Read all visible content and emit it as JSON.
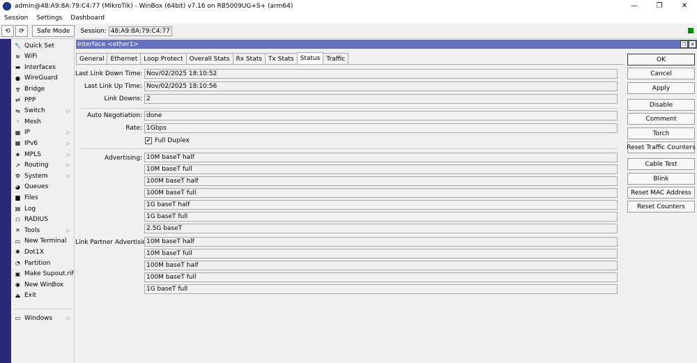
{
  "window": {
    "title": "admin@48:A9:8A:79:C4:77 (MikroTik) - WinBox (64bit) v7.16 on RB5009UG+S+ (arm64)",
    "minimize": "—",
    "maximize": "❐",
    "close": "✕"
  },
  "menu": [
    "Session",
    "Settings",
    "Dashboard"
  ],
  "toolbar": {
    "undo": "⟲",
    "redo": "⟳",
    "safe_mode": "Safe Mode",
    "session_label": "Session:",
    "session_value": "48:A9:8A:79:C4:77"
  },
  "sidebar": [
    {
      "label": "Quick Set",
      "icon": "quick-set-icon",
      "glyph": "🔧",
      "arrow": false
    },
    {
      "label": "WiFi",
      "icon": "wifi-icon",
      "glyph": "≋",
      "arrow": false
    },
    {
      "label": "Interfaces",
      "icon": "interfaces-icon",
      "glyph": "▬",
      "arrow": false
    },
    {
      "label": "WireGuard",
      "icon": "wireguard-icon",
      "glyph": "●",
      "arrow": false
    },
    {
      "label": "Bridge",
      "icon": "bridge-icon",
      "glyph": "╦",
      "arrow": false
    },
    {
      "label": "PPP",
      "icon": "ppp-icon",
      "glyph": "⇄",
      "arrow": false
    },
    {
      "label": "Switch",
      "icon": "switch-icon",
      "glyph": "⇋",
      "arrow": true
    },
    {
      "label": "Mesh",
      "icon": "mesh-icon",
      "glyph": "⁖",
      "arrow": false
    },
    {
      "label": "IP",
      "icon": "ip-icon",
      "glyph": "▦",
      "arrow": true
    },
    {
      "label": "IPv6",
      "icon": "ipv6-icon",
      "glyph": "▦",
      "arrow": true
    },
    {
      "label": "MPLS",
      "icon": "mpls-icon",
      "glyph": "◈",
      "arrow": true
    },
    {
      "label": "Routing",
      "icon": "routing-icon",
      "glyph": "↗",
      "arrow": true
    },
    {
      "label": "System",
      "icon": "system-icon",
      "glyph": "⚙",
      "arrow": true
    },
    {
      "label": "Queues",
      "icon": "queues-icon",
      "glyph": "◕",
      "arrow": false
    },
    {
      "label": "Files",
      "icon": "files-icon",
      "glyph": "▆",
      "arrow": false
    },
    {
      "label": "Log",
      "icon": "log-icon",
      "glyph": "▤",
      "arrow": false
    },
    {
      "label": "RADIUS",
      "icon": "radius-icon",
      "glyph": "⚇",
      "arrow": false
    },
    {
      "label": "Tools",
      "icon": "tools-icon",
      "glyph": "✕",
      "arrow": true
    },
    {
      "label": "New Terminal",
      "icon": "terminal-icon",
      "glyph": "▭",
      "arrow": false
    },
    {
      "label": "Dot1X",
      "icon": "dot1x-icon",
      "glyph": "✱",
      "arrow": false
    },
    {
      "label": "Partition",
      "icon": "partition-icon",
      "glyph": "◔",
      "arrow": false
    },
    {
      "label": "Make Supout.rif",
      "icon": "supout-icon",
      "glyph": "▣",
      "arrow": false
    },
    {
      "label": "New WinBox",
      "icon": "winbox-icon",
      "glyph": "◉",
      "arrow": false
    },
    {
      "label": "Exit",
      "icon": "exit-icon",
      "glyph": "⏏",
      "arrow": false
    }
  ],
  "sidebar_windows": {
    "label": "Windows",
    "icon": "windows-icon",
    "glyph": "▭",
    "arrow": true
  },
  "sidebar_arrow_glyph": "▷",
  "interface_window": {
    "title": "Interface <ether1>",
    "restore_glyph": "❐",
    "close_glyph": "✕"
  },
  "tabs": [
    {
      "label": "General",
      "active": false
    },
    {
      "label": "Ethernet",
      "active": false
    },
    {
      "label": "Loop Protect",
      "active": false
    },
    {
      "label": "Overall Stats",
      "active": false
    },
    {
      "label": "Rx Stats",
      "active": false
    },
    {
      "label": "Tx Stats",
      "active": false
    },
    {
      "label": "Status",
      "active": true
    },
    {
      "label": "Traffic",
      "active": false
    }
  ],
  "status": {
    "last_link_down_label": "Last Link Down Time:",
    "last_link_down": "Nov/02/2025 18:10:52",
    "last_link_up_label": "Last Link Up Time:",
    "last_link_up": "Nov/02/2025 18:10:56",
    "link_downs_label": "Link Downs:",
    "link_downs": "2",
    "auto_neg_label": "Auto Negotiation:",
    "auto_neg": "done",
    "rate_label": "Rate:",
    "rate": "1Gbps",
    "full_duplex_label": "Full Duplex",
    "full_duplex_check": "✔",
    "advertising_label": "Advertising:",
    "advertising": [
      "10M baseT half",
      "10M baseT full",
      "100M baseT half",
      "100M baseT full",
      "1G baseT half",
      "1G baseT full",
      "2.5G baseT"
    ],
    "partner_label": "Link Partner Advertising:",
    "partner": [
      "10M baseT half",
      "10M baseT full",
      "100M baseT half",
      "100M baseT full",
      "1G baseT full"
    ]
  },
  "buttons": {
    "ok": "OK",
    "cancel": "Cancel",
    "apply": "Apply",
    "disable": "Disable",
    "comment": "Comment",
    "torch": "Torch",
    "reset_traffic": "Reset Traffic Counters",
    "cable_test": "Cable Test",
    "blink": "Blink",
    "reset_mac": "Reset MAC Address",
    "reset_counters": "Reset Counters"
  },
  "colors": {
    "title_accent": "#6670bd",
    "sidebar_strip": "#2a2a7a",
    "status_ok": "#0a8a0a"
  }
}
